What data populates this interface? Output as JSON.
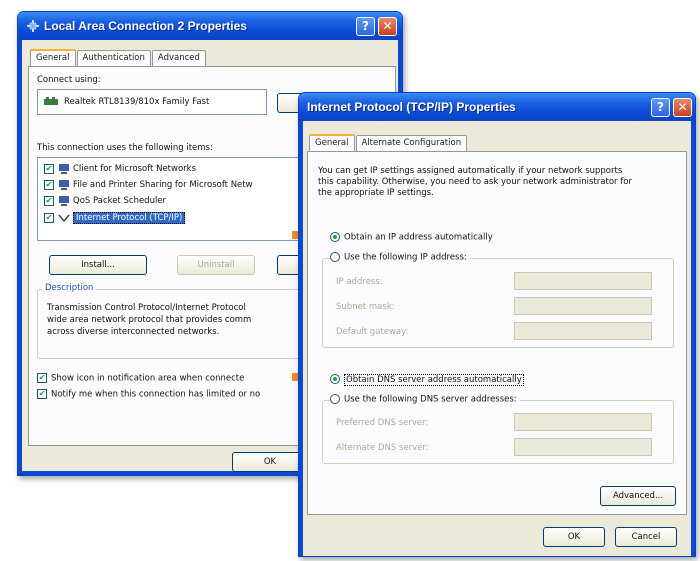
{
  "lan_window": {
    "title": "Local Area Connection 2 Properties",
    "tabs": [
      "General",
      "Authentication",
      "Advanced"
    ],
    "connect_using_label": "Connect using:",
    "adapter_name": "Realtek RTL8139/810x Family Fast",
    "items_label": "This connection uses the following items:",
    "items": [
      {
        "label": "Client for Microsoft Networks",
        "checked": true,
        "selected": false
      },
      {
        "label": "File and Printer Sharing for Microsoft Netw",
        "checked": true,
        "selected": false
      },
      {
        "label": "QoS Packet Scheduler",
        "checked": true,
        "selected": false
      },
      {
        "label": "Internet Protocol (TCP/IP)",
        "checked": true,
        "selected": true
      }
    ],
    "install_button": "Install...",
    "uninstall_button": "Uninstall",
    "description_label": "Description",
    "description_text": [
      "Transmission Control Protocol/Internet Protocol",
      "wide area network protocol that provides comm",
      "across diverse interconnected networks."
    ],
    "show_icon_label": "Show icon in notification area when connecte",
    "notify_label": "Notify me when this connection has limited or no",
    "ok_button": "OK"
  },
  "tcpip_window": {
    "title": "Internet Protocol (TCP/IP) Properties",
    "tabs": [
      "General",
      "Alternate Configuration"
    ],
    "intro_text": [
      "You can get IP settings assigned automatically if your network supports",
      "this capability. Otherwise, you need to ask your network administrator for",
      "the appropriate IP settings."
    ],
    "obtain_ip_auto": "Obtain an IP address automatically",
    "use_following_ip": "Use the following IP address:",
    "ip_address_label": "IP address:",
    "subnet_mask_label": "Subnet mask:",
    "default_gateway_label": "Default gateway:",
    "obtain_dns_auto": "Obtain DNS server address automatically",
    "use_following_dns": "Use the following DNS server addresses:",
    "preferred_dns_label": "Preferred DNS server:",
    "alternate_dns_label": "Alternate DNS server:",
    "advanced_button": "Advanced...",
    "ok_button": "OK",
    "cancel_button": "Cancel",
    "obtain_ip_selected": true,
    "obtain_dns_selected": true
  },
  "colors": {
    "title_bar": "#0a4cd6",
    "arrow": "#f08a24",
    "selection": "#316ac5"
  }
}
